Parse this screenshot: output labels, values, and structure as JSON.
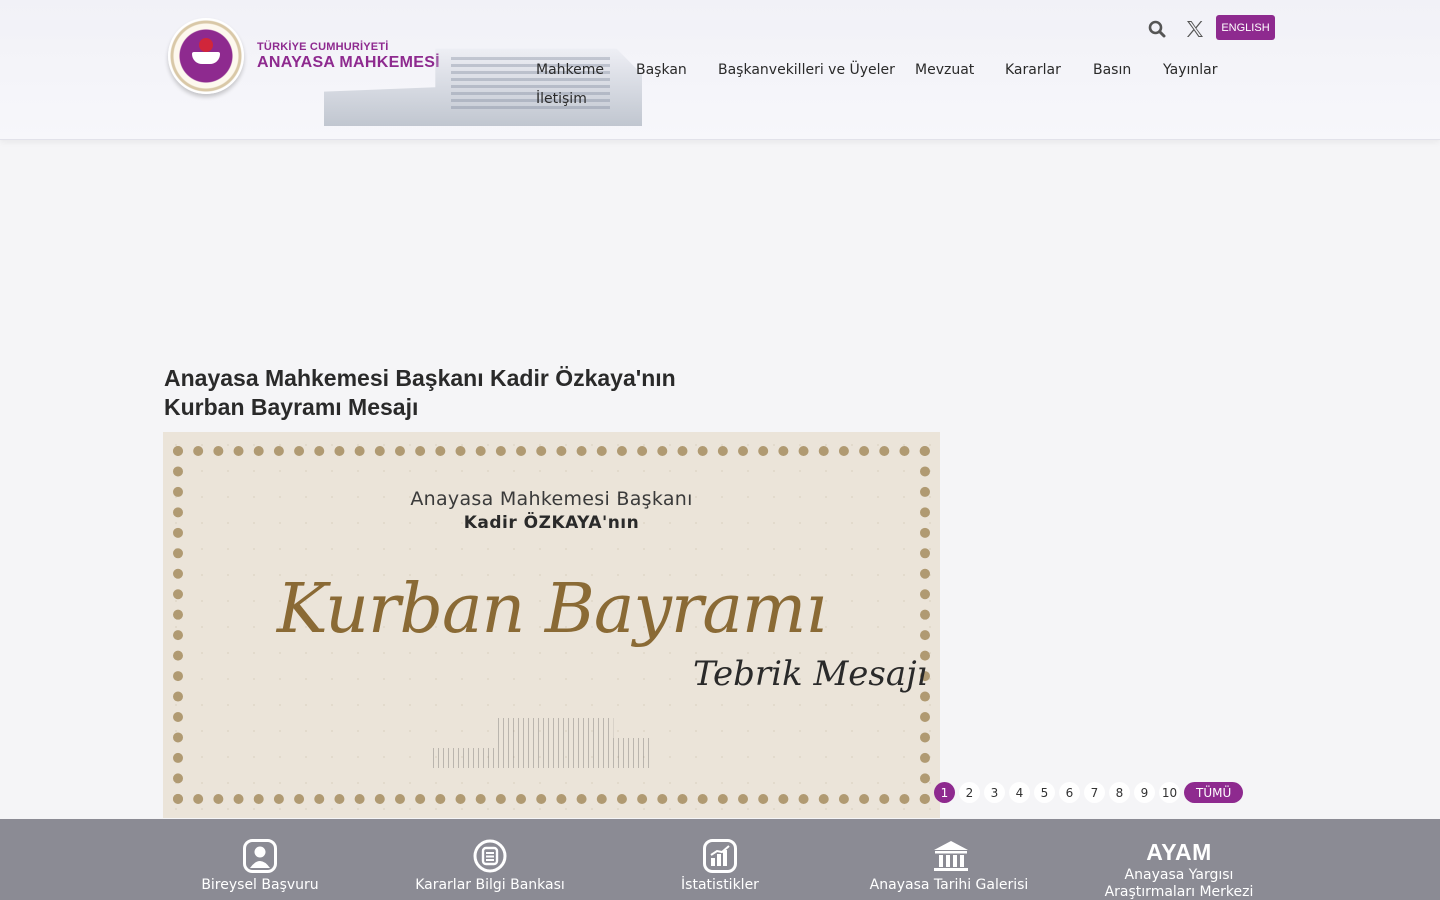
{
  "header": {
    "org_top": "TÜRKİYE CUMHURİYETİ",
    "org_main": "ANAYASA MAHKEMESİ",
    "language_button": "ENGLISH",
    "icons": {
      "search": "search-icon",
      "social": "x-twitter-icon",
      "logo": "court-seal-logo"
    },
    "nav": [
      "Mahkeme",
      "Başkan",
      "Başkanvekilleri ve Üyeler",
      "Mevzuat",
      "Kararlar",
      "Basın",
      "Yayınlar",
      "İletişim"
    ]
  },
  "article": {
    "title_line1": "Anayasa Mahkemesi Başkanı Kadir Özkaya'nın",
    "title_line2": "Kurban Bayramı Mesajı",
    "hero": {
      "line1": "Anayasa Mahkemesi Başkanı",
      "line2": "Kadir ÖZKAYA'nın",
      "script_main": "Kurban Bayramı",
      "script_sub": "Tebrik Mesajı"
    }
  },
  "pagination": {
    "pages": [
      "1",
      "2",
      "3",
      "4",
      "5",
      "6",
      "7",
      "8",
      "9",
      "10"
    ],
    "active_page": "1",
    "all_label": "TÜMÜ"
  },
  "quick_links": [
    {
      "label": "Bireysel Başvuru",
      "icon": "user-portrait-icon"
    },
    {
      "label": "Kararlar Bilgi Bankası",
      "icon": "document-list-icon"
    },
    {
      "label": "İstatistikler",
      "icon": "bar-chart-icon"
    },
    {
      "label": "Anayasa Tarihi Galerisi",
      "icon": "courthouse-icon"
    },
    {
      "logo_text": "AYAM",
      "label_line1": "Anayasa Yargısı",
      "label_line2": "Araştırmaları Merkezi"
    }
  ],
  "colors": {
    "accent": "#8e2a8f",
    "bottom_bar": "#8b8b94",
    "page_bg": "#f5f5f7"
  }
}
